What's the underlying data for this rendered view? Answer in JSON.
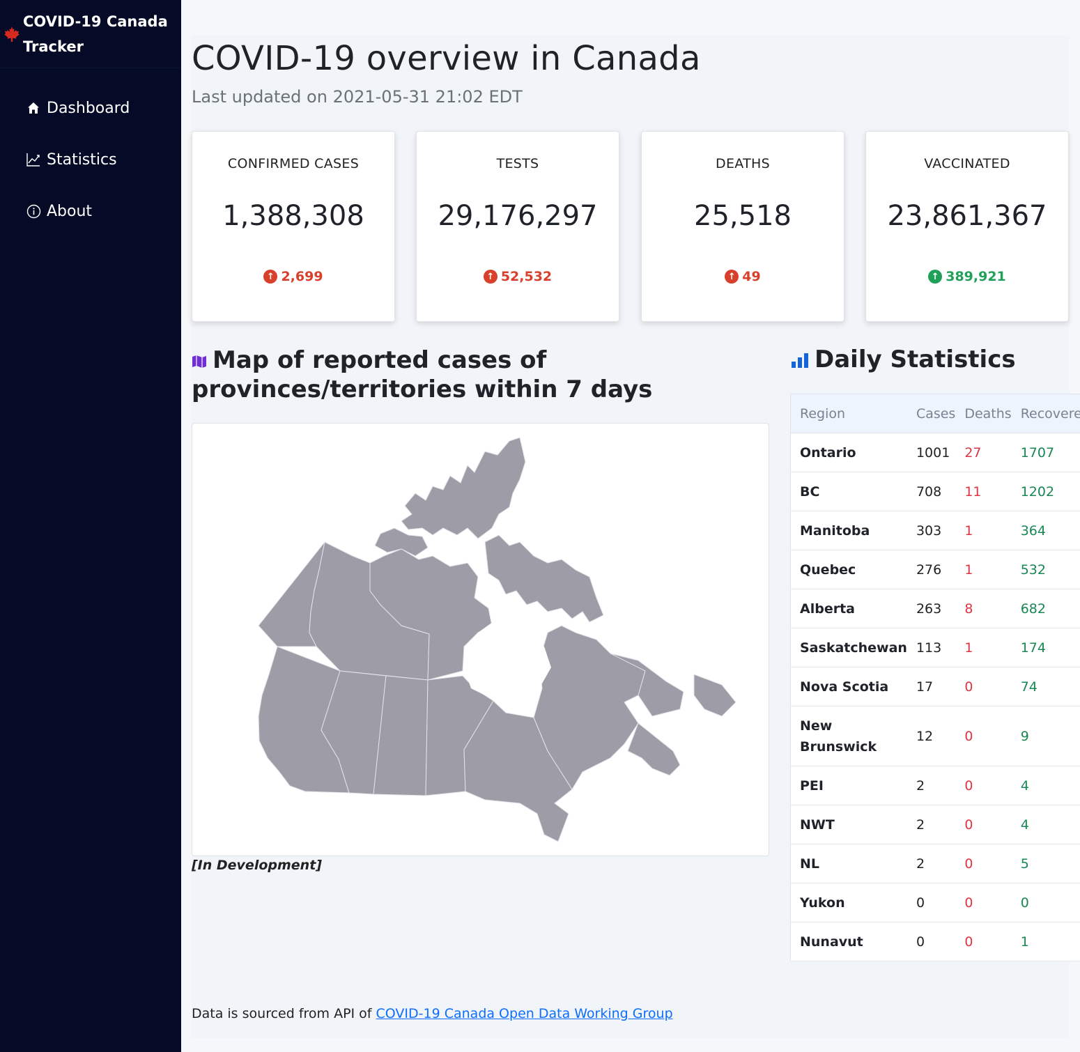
{
  "sidebar": {
    "brand_line1": "COVID-19 Canada",
    "brand_line2": "Tracker",
    "items": [
      {
        "label": "Dashboard",
        "icon": "home-icon"
      },
      {
        "label": "Statistics",
        "icon": "chart-line-icon"
      },
      {
        "label": "About",
        "icon": "info-icon"
      }
    ]
  },
  "header": {
    "title": "COVID-19 overview in Canada",
    "subtitle": "Last updated on 2021-05-31 21:02 EDT"
  },
  "cards": [
    {
      "label": "CONFIRMED CASES",
      "value": "1,388,308",
      "delta": "2,699",
      "trend": "up",
      "color": "#d9402b"
    },
    {
      "label": "TESTS",
      "value": "29,176,297",
      "delta": "52,532",
      "trend": "up",
      "color": "#d9402b"
    },
    {
      "label": "DEATHS",
      "value": "25,518",
      "delta": "49",
      "trend": "up",
      "color": "#d9402b"
    },
    {
      "label": "VACCINATED",
      "value": "23,861,367",
      "delta": "389,921",
      "trend": "up",
      "color": "#21a05a"
    }
  ],
  "map": {
    "heading": "Map of reported cases of provinces/territories within 7 days",
    "note": "[In Development]",
    "fill_color": "#9d9ca7"
  },
  "stats": {
    "heading": "Daily Statistics",
    "columns": [
      "Region",
      "Cases",
      "Deaths",
      "Recovered"
    ],
    "rows": [
      {
        "region": "Ontario",
        "cases": "1001",
        "deaths": "27",
        "recovered": "1707"
      },
      {
        "region": "BC",
        "cases": "708",
        "deaths": "11",
        "recovered": "1202"
      },
      {
        "region": "Manitoba",
        "cases": "303",
        "deaths": "1",
        "recovered": "364"
      },
      {
        "region": "Quebec",
        "cases": "276",
        "deaths": "1",
        "recovered": "532"
      },
      {
        "region": "Alberta",
        "cases": "263",
        "deaths": "8",
        "recovered": "682"
      },
      {
        "region": "Saskatchewan",
        "cases": "113",
        "deaths": "1",
        "recovered": "174"
      },
      {
        "region": "Nova Scotia",
        "cases": "17",
        "deaths": "0",
        "recovered": "74"
      },
      {
        "region": "New Brunswick",
        "cases": "12",
        "deaths": "0",
        "recovered": "9"
      },
      {
        "region": "PEI",
        "cases": "2",
        "deaths": "0",
        "recovered": "4"
      },
      {
        "region": "NWT",
        "cases": "2",
        "deaths": "0",
        "recovered": "4"
      },
      {
        "region": "NL",
        "cases": "2",
        "deaths": "0",
        "recovered": "5"
      },
      {
        "region": "Yukon",
        "cases": "0",
        "deaths": "0",
        "recovered": "0"
      },
      {
        "region": "Nunavut",
        "cases": "0",
        "deaths": "0",
        "recovered": "1"
      }
    ]
  },
  "footer": {
    "text": "Data is sourced from API of ",
    "link_text": "COVID-19 Canada Open Data Working Group"
  }
}
